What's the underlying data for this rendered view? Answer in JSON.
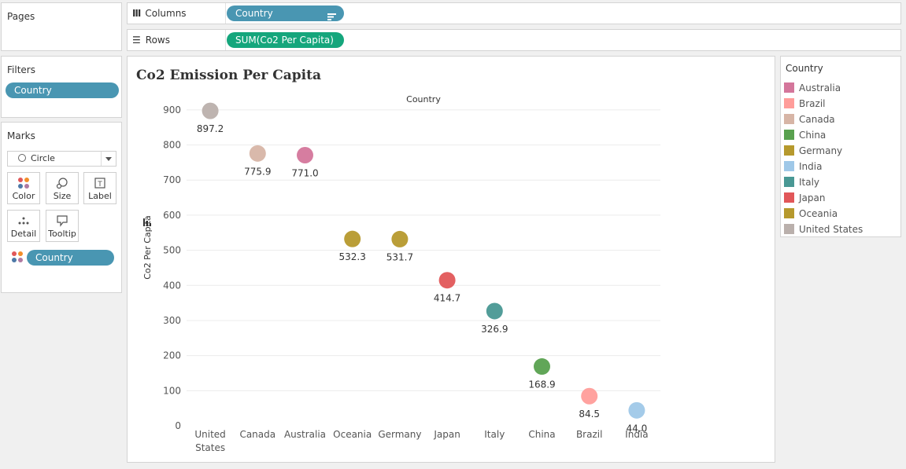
{
  "pages": {
    "title": "Pages"
  },
  "shelves": {
    "columns": {
      "label": "Columns",
      "pill": "Country"
    },
    "rows": {
      "label": "Rows",
      "pill": "SUM(Co2 Per Capita)"
    }
  },
  "filters": {
    "title": "Filters",
    "pill": "Country"
  },
  "marks": {
    "title": "Marks",
    "mark_type": "Circle",
    "buttons": {
      "color": "Color",
      "size": "Size",
      "label": "Label",
      "detail": "Detail",
      "tooltip": "Tooltip"
    },
    "color_pill": "Country"
  },
  "legend": {
    "title": "Country",
    "items": [
      {
        "name": "Australia",
        "color": "#d4769b"
      },
      {
        "name": "Brazil",
        "color": "#ff9d9a"
      },
      {
        "name": "Canada",
        "color": "#d7b5a6"
      },
      {
        "name": "China",
        "color": "#59a14f"
      },
      {
        "name": "Germany",
        "color": "#b6992d"
      },
      {
        "name": "India",
        "color": "#9fc8e8"
      },
      {
        "name": "Italy",
        "color": "#499894"
      },
      {
        "name": "Japan",
        "color": "#e15759"
      },
      {
        "name": "Oceania",
        "color": "#b6992d"
      },
      {
        "name": "United States",
        "color": "#bab0ac"
      }
    ]
  },
  "chart_data": {
    "type": "scatter",
    "title": "Co2 Emission Per Capita",
    "header": "Country",
    "ylabel": "Co2 Per Capita",
    "ylim": [
      0,
      940
    ],
    "yticks": [
      0,
      100,
      200,
      300,
      400,
      500,
      600,
      700,
      800,
      900
    ],
    "grid": true,
    "categories": [
      "United States",
      "Canada",
      "Australia",
      "Oceania",
      "Germany",
      "Japan",
      "Italy",
      "China",
      "Brazil",
      "India"
    ],
    "category_labels": [
      [
        "United",
        "States"
      ],
      [
        "Canada"
      ],
      [
        "Australia"
      ],
      [
        "Oceania"
      ],
      [
        "Germany"
      ],
      [
        "Japan"
      ],
      [
        "Italy"
      ],
      [
        "China"
      ],
      [
        "Brazil"
      ],
      [
        "India"
      ]
    ],
    "values": [
      897.2,
      775.9,
      771.0,
      532.3,
      531.7,
      414.7,
      326.9,
      168.9,
      84.5,
      44.0
    ],
    "labels": [
      "897.2",
      "775.9",
      "771.0",
      "532.3",
      "531.7",
      "414.7",
      "326.9",
      "168.9",
      "84.5",
      "44.0"
    ],
    "colors": [
      "#bab0ac",
      "#d7b5a6",
      "#d4769b",
      "#b6992d",
      "#b6992d",
      "#e15759",
      "#499894",
      "#59a14f",
      "#ff9d9a",
      "#9fc8e8"
    ]
  }
}
